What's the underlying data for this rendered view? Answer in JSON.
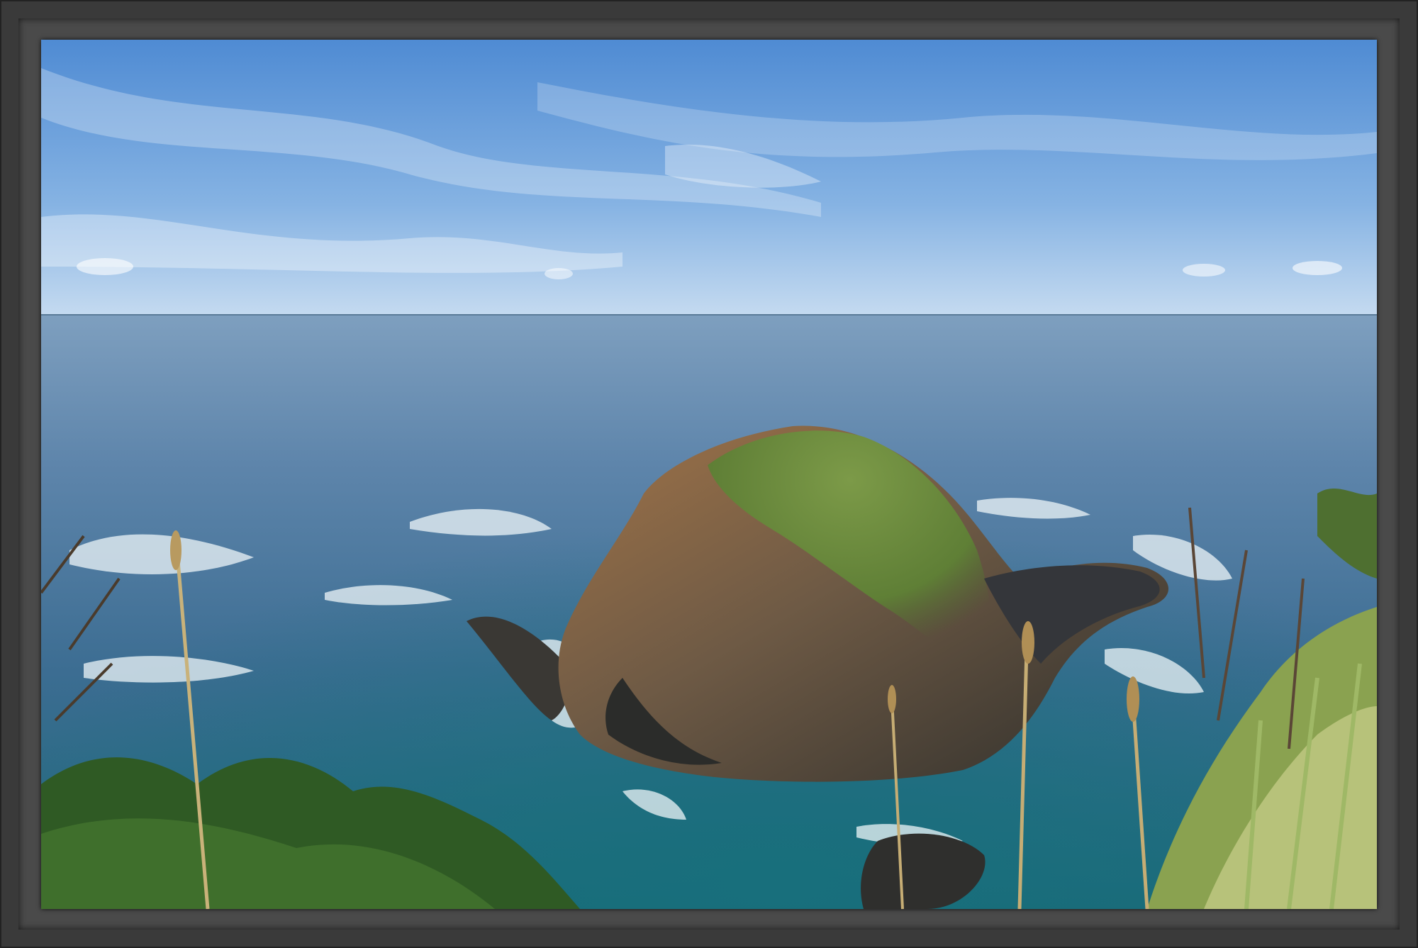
{
  "frame": {
    "frame_color": "#3b3b3b",
    "mat_color": "#4a4a4a"
  },
  "photo": {
    "subject": "seascape-with-grassy-rock-island",
    "palette": {
      "sky_top": "#5b93d6",
      "sky_horizon": "#bdd6ee",
      "sea_far": "#5d84a8",
      "sea_near": "#1f6f7c",
      "rock_dark": "#3b3a36",
      "rock_ochre": "#9a6b42",
      "grass": "#6d8a3c",
      "foliage": "#3f6b2a"
    }
  }
}
